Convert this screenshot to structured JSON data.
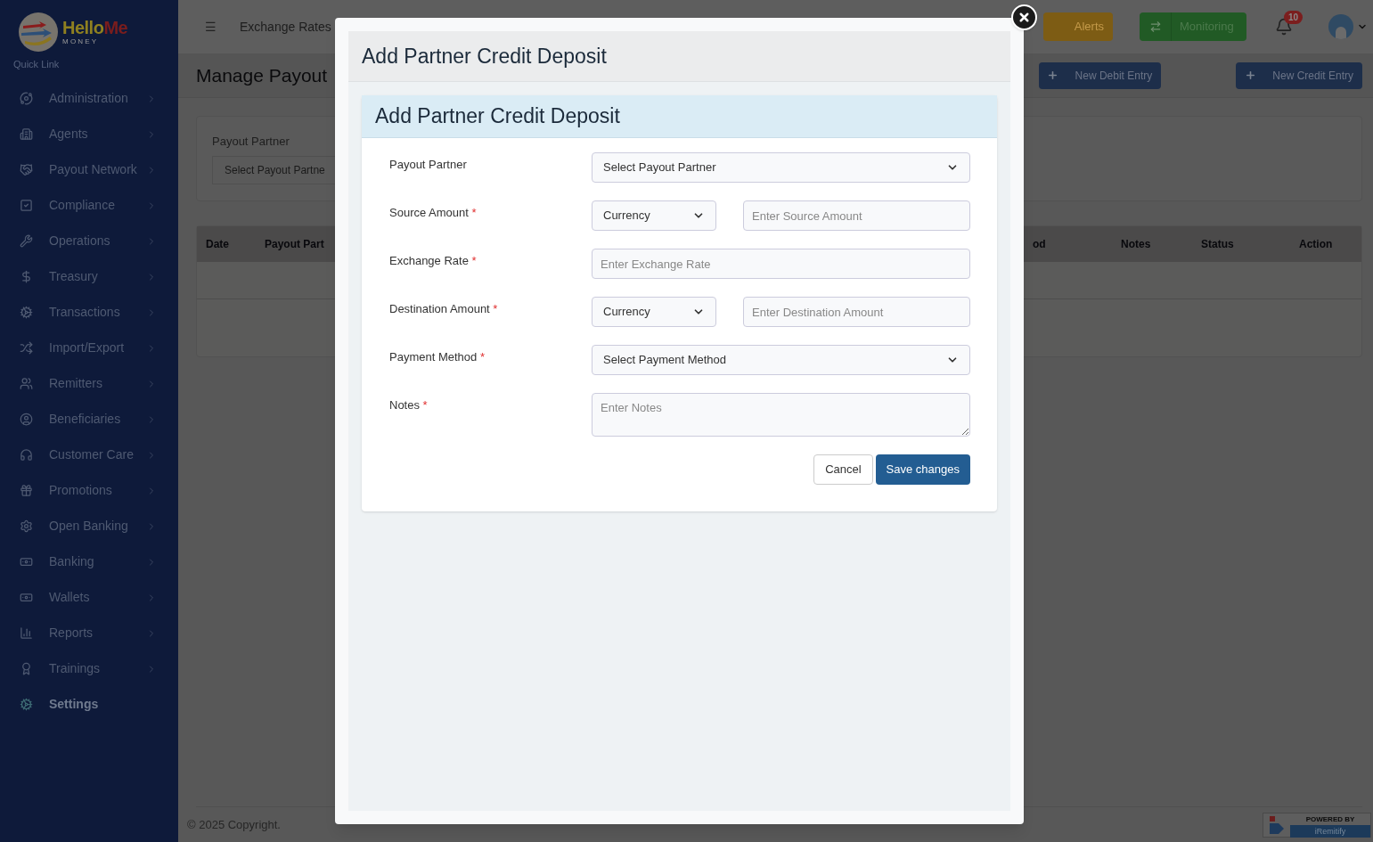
{
  "logo": {
    "part_1": "Hello",
    "part_2": "Me",
    "subtitle": "M O N E Y"
  },
  "sidebar": {
    "section": "Quick Link",
    "items": [
      {
        "label": "Administration",
        "selected": false
      },
      {
        "label": "Agents",
        "selected": false
      },
      {
        "label": "Payout Network",
        "selected": false
      },
      {
        "label": "Compliance",
        "selected": false
      },
      {
        "label": "Operations",
        "selected": false
      },
      {
        "label": "Treasury",
        "selected": false
      },
      {
        "label": "Transactions",
        "selected": false
      },
      {
        "label": "Import/Export",
        "selected": false
      },
      {
        "label": "Remitters",
        "selected": false
      },
      {
        "label": "Beneficiaries",
        "selected": false
      },
      {
        "label": "Customer Care",
        "selected": false
      },
      {
        "label": "Promotions",
        "selected": false
      },
      {
        "label": "Open Banking",
        "selected": false
      },
      {
        "label": "Banking",
        "selected": false
      },
      {
        "label": "Wallets",
        "selected": false
      },
      {
        "label": "Reports",
        "selected": false
      },
      {
        "label": "Trainings",
        "selected": false
      },
      {
        "label": "Settings",
        "selected": true
      }
    ]
  },
  "topbar": {
    "menu": "☰",
    "dropdown": "Exchange Rates",
    "alerts": "Alerts",
    "monitoring": "Monitoring",
    "notifications": "10"
  },
  "page": {
    "title": "Manage Payout",
    "buttons": [
      "New Debit Entry",
      "New Credit Entry"
    ],
    "filter": {
      "label": "Payout Partner",
      "placeholder": "Select Payout Partne"
    },
    "table": {
      "columns": [
        "Date",
        "Payout Part",
        "od",
        "Notes",
        "Status",
        "Action"
      ]
    }
  },
  "footer": {
    "copyright": "© 2025 Copyright.",
    "powered_by": "POWERED BY",
    "brand": "iRemitify"
  },
  "modal": {
    "title": "Add Partner Credit Deposit",
    "card_title": "Add Partner Credit Deposit",
    "required_mark": "*",
    "fields": [
      {
        "label": "Payout Partner",
        "required": false,
        "kind": "select",
        "value": "Select Payout Partner"
      },
      {
        "label": "Source Amount",
        "required": true,
        "kind": "currency",
        "currency": "Currency",
        "placeholder": "Enter Source Amount"
      },
      {
        "label": "Exchange Rate",
        "required": true,
        "kind": "input",
        "placeholder": "Enter Exchange Rate"
      },
      {
        "label": "Destination Amount",
        "required": true,
        "kind": "currency",
        "currency": "Currency",
        "placeholder": "Enter Destination Amount"
      },
      {
        "label": "Payment Method",
        "required": true,
        "kind": "select",
        "value": "Select Payment Method"
      },
      {
        "label": "Notes",
        "required": true,
        "kind": "textarea",
        "placeholder": "Enter Notes"
      }
    ],
    "cancel": "Cancel",
    "save": "Save changes"
  }
}
